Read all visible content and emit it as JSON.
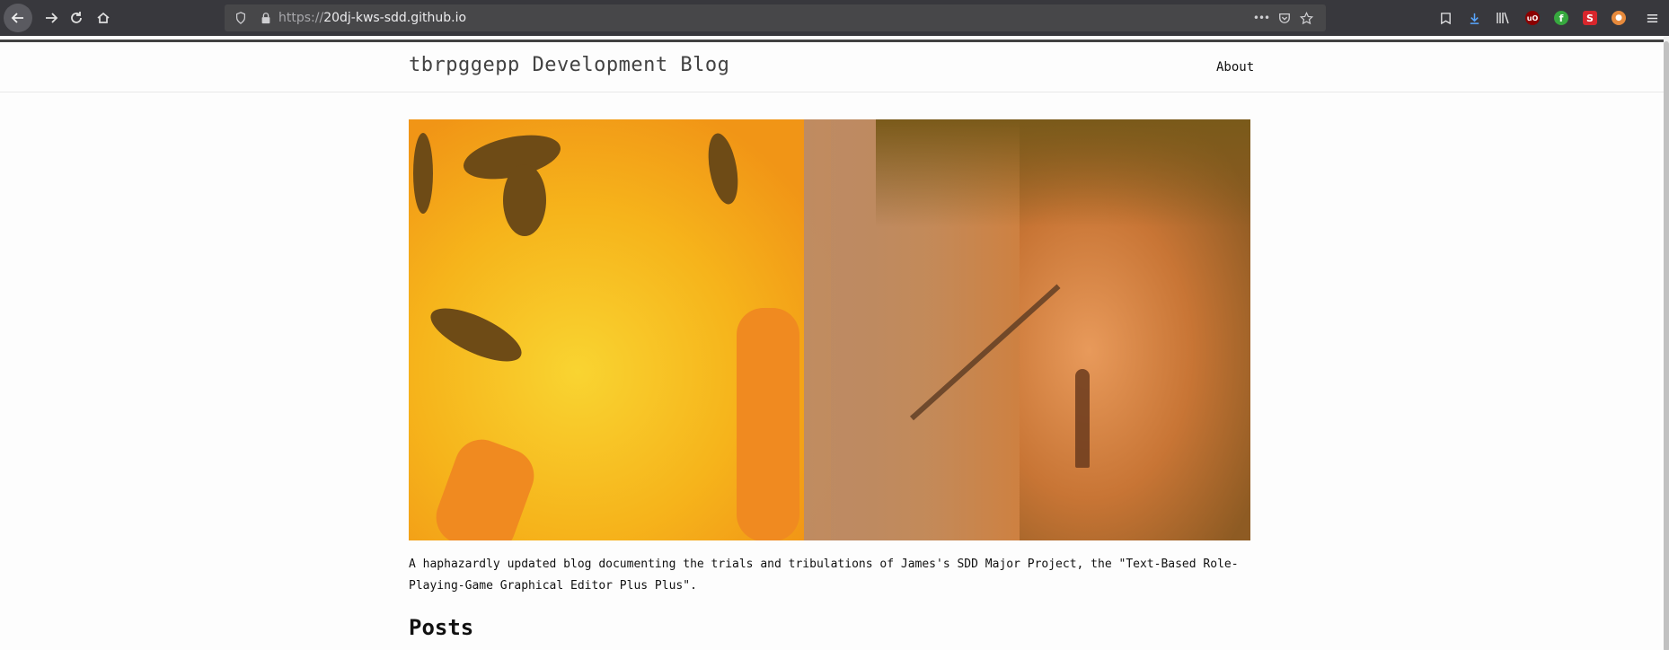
{
  "browser": {
    "url_scheme": "https://",
    "url_host": "20dj-kws-sdd.github.io",
    "page_actions_label": "•••"
  },
  "site": {
    "title": "tbrpggepp Development Blog",
    "nav": [
      {
        "label": "About"
      }
    ]
  },
  "hero": {
    "image_subject": "blade-runner-emoji-illustration"
  },
  "main": {
    "intro": "A haphazardly updated blog documenting the trials and tribulations of James's SDD Major Project, the \"Text-Based Role-Playing-Game Graphical Editor Plus Plus\".",
    "posts_heading": "Posts"
  },
  "colors": {
    "chrome_bg": "#38383d",
    "urlbar_bg": "#474749",
    "page_bg": "#fdfdfd",
    "text": "#111111"
  }
}
